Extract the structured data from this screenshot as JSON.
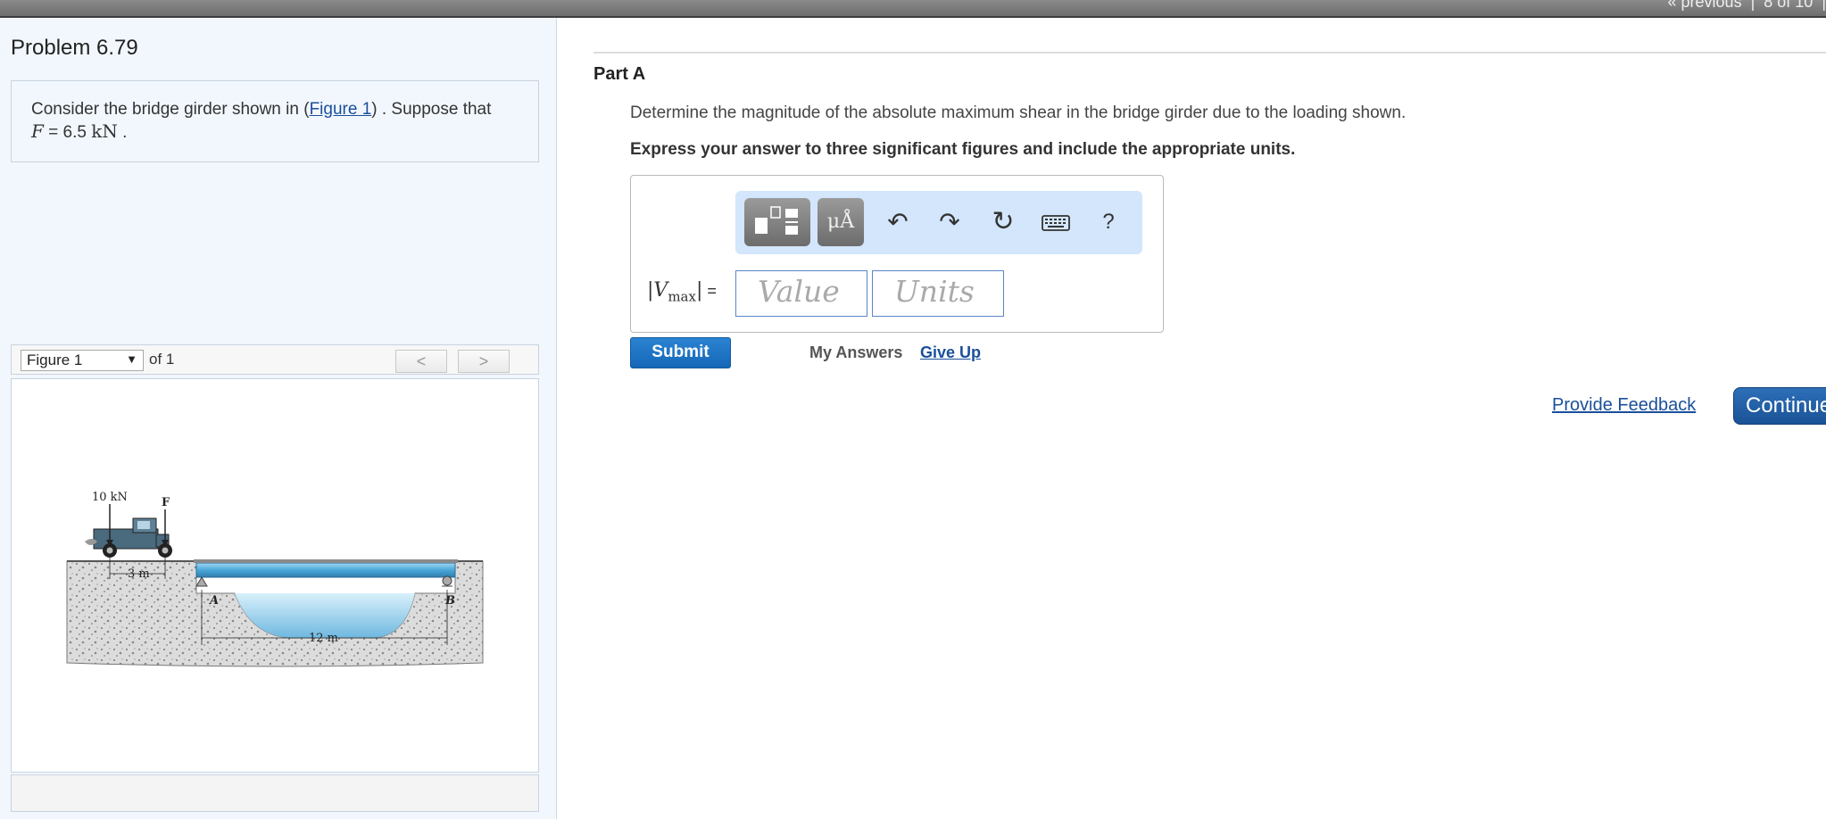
{
  "topnav": {
    "previous": "« previous",
    "position": "8 of 10"
  },
  "problem": {
    "title": "Problem 6.79",
    "intro_before": "Consider the bridge girder shown in (",
    "intro_link": "Figure 1",
    "intro_after": ") . Suppose that",
    "var_F": "F",
    "eq": " = 6.5 ",
    "unit": "kN",
    "period": " ."
  },
  "figure": {
    "selected": "Figure 1",
    "of": "of 1",
    "prev": "<",
    "next": ">",
    "labels": {
      "load1": "10 kN",
      "load2": "F",
      "spacing": "3 m",
      "span": "12 m",
      "support_a": "A",
      "support_b": "B"
    }
  },
  "part": {
    "title": "Part A",
    "question": "Determine the magnitude of the absolute maximum shear in the bridge girder due to the loading shown.",
    "instruction": "Express your answer to three significant figures and include the appropriate units."
  },
  "toolbar": {
    "symbols": "μÅ",
    "undo": "↶",
    "redo": "↷",
    "reset": "↻",
    "help": "?"
  },
  "answer": {
    "var_main": "V",
    "var_sub": "max",
    "equals": " =",
    "value_placeholder": "Value",
    "units_placeholder": "Units"
  },
  "actions": {
    "submit": "Submit",
    "my_answers": "My Answers",
    "give_up": "Give Up",
    "feedback": "Provide Feedback",
    "continue": "Continue"
  },
  "colors": {
    "accent": "#1a6bbf",
    "toolbar_bg": "#d3e6fb",
    "left_panel_bg": "#f2f7fd",
    "water": "#6fb8e0"
  }
}
